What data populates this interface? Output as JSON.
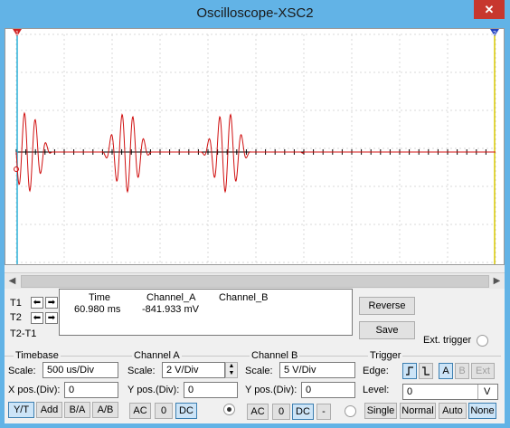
{
  "window": {
    "title": "Oscilloscope-XSC2",
    "close_glyph": "✕"
  },
  "screen": {
    "cursor1_label": "1",
    "cursor2_label": "2",
    "trace_color": "#d01010",
    "background": "#ffffff",
    "grid_color": "#d8d8d8"
  },
  "readout": {
    "t1_label": "T1",
    "t2_label": "T2",
    "t2t1_label": "T2-T1",
    "col_time": "Time",
    "col_channel_a": "Channel_A",
    "col_channel_b": "Channel_B",
    "t1_time": "60.980 ms",
    "t1_channel_a": "-841.933 mV",
    "t1_channel_b": ""
  },
  "side_buttons": {
    "reverse": "Reverse",
    "save": "Save",
    "ext_trigger": "Ext. trigger"
  },
  "timebase": {
    "group_label": "Timebase",
    "scale_label": "Scale:",
    "scale_value": "500 us/Div",
    "xpos_label": "X pos.(Div):",
    "xpos_value": "0",
    "modes": [
      "Y/T",
      "Add",
      "B/A",
      "A/B"
    ],
    "selected_mode": "Y/T"
  },
  "channel_a": {
    "group_label": "Channel A",
    "scale_label": "Scale:",
    "scale_value": "2  V/Div",
    "ypos_label": "Y pos.(Div):",
    "ypos_value": "0",
    "coupling": [
      "AC",
      "0",
      "DC"
    ],
    "selected_coupling": "DC"
  },
  "channel_b": {
    "group_label": "Channel B",
    "scale_label": "Scale:",
    "scale_value": "5  V/Div",
    "ypos_label": "Y pos.(Div):",
    "ypos_value": "0",
    "coupling": [
      "AC",
      "0",
      "DC",
      "-"
    ],
    "selected_coupling": "DC"
  },
  "trigger": {
    "group_label": "Trigger",
    "edge_label": "Edge:",
    "edge_rising_glyph": "⎍",
    "edge_falling_glyph": "⎍",
    "sources": [
      "A",
      "B",
      "Ext"
    ],
    "selected_source": "A",
    "level_label": "Level:",
    "level_value": "0",
    "level_unit": "V",
    "modes": [
      "Single",
      "Normal",
      "Auto",
      "None"
    ],
    "selected_mode": "None"
  }
}
